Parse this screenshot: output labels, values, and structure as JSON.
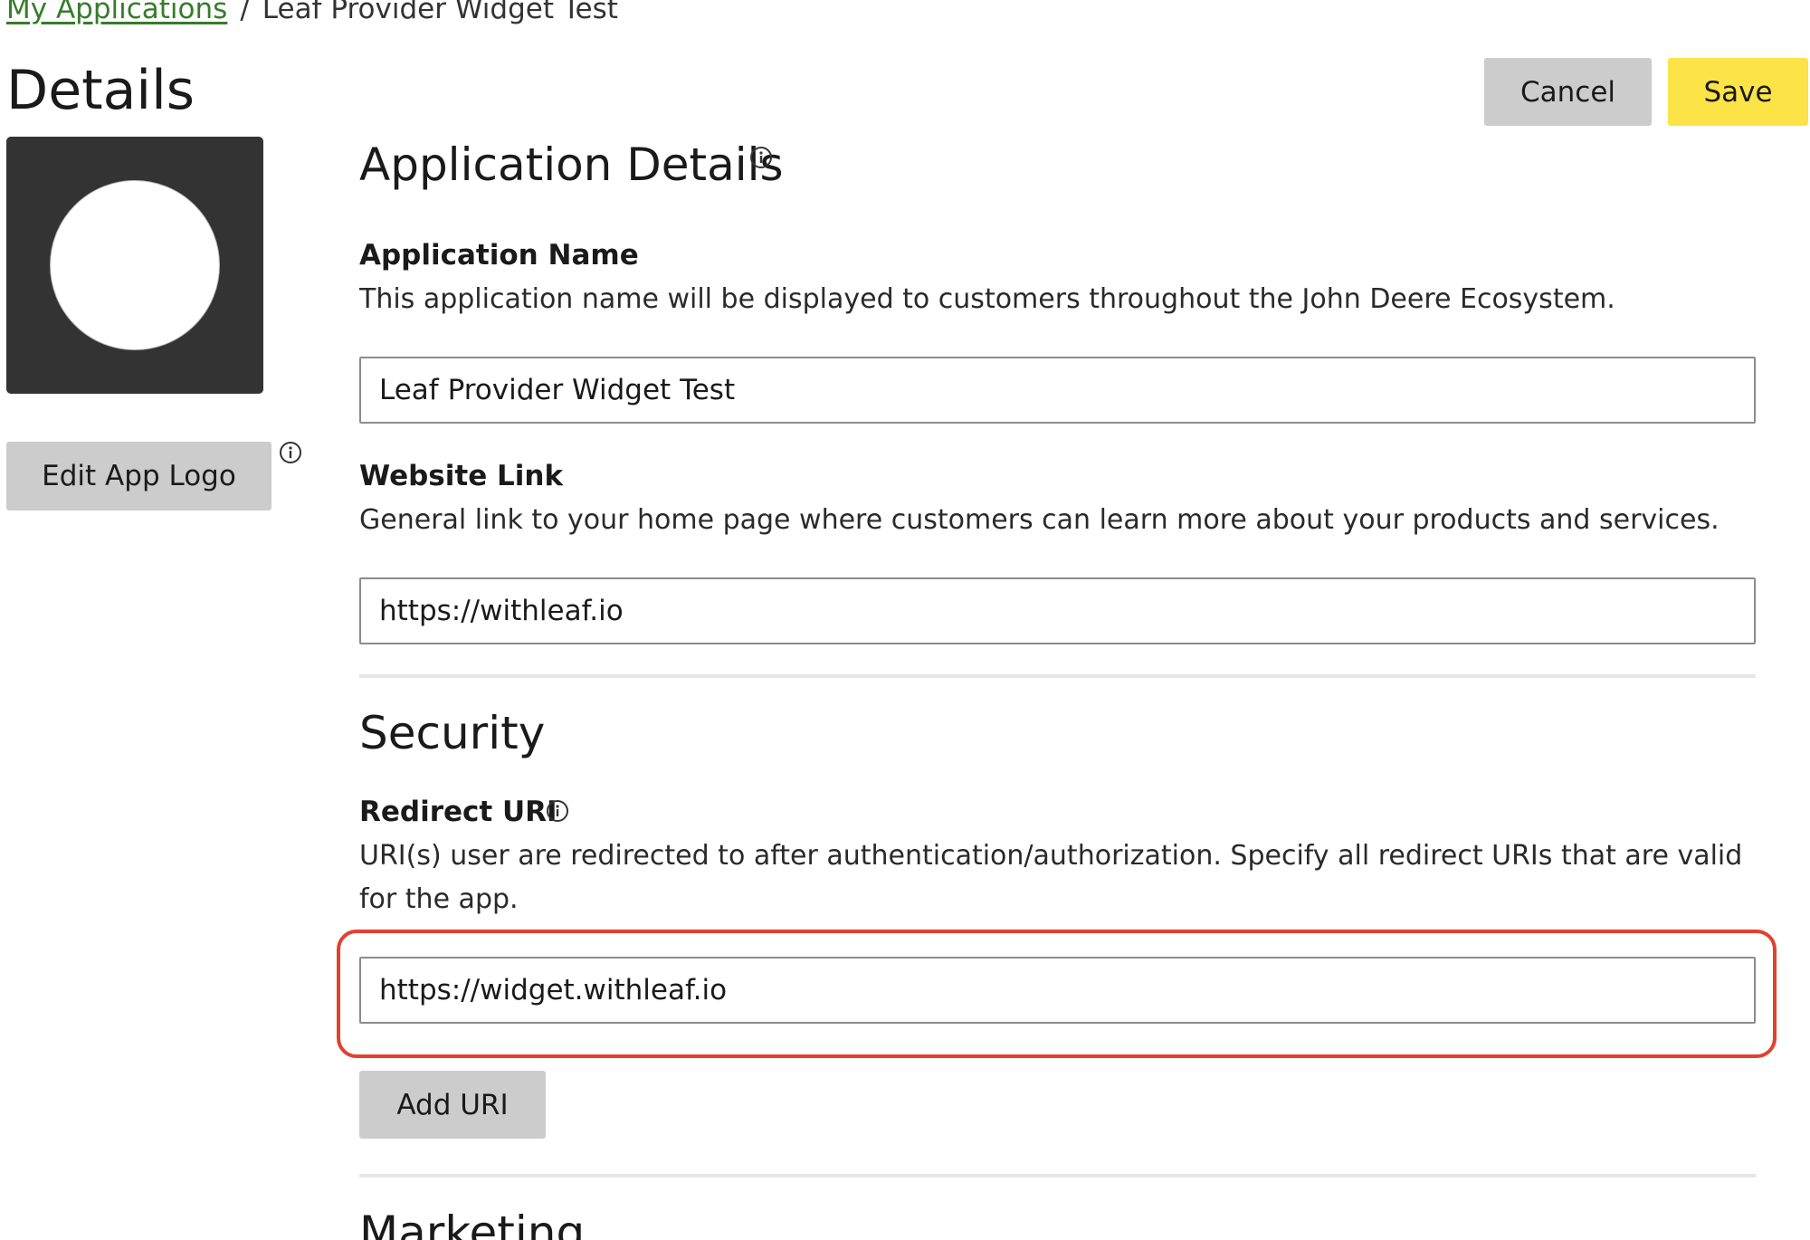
{
  "breadcrumb": {
    "parent_label": "My Applications",
    "separator": "/",
    "current_label": "Leaf Provider Widget Test"
  },
  "page_title": "Details",
  "header_actions": {
    "cancel_label": "Cancel",
    "save_label": "Save",
    "save_color": "#fbe348",
    "cancel_color": "#cccccc"
  },
  "logo_panel": {
    "edit_logo_label": "Edit App Logo",
    "info_icon": "info-icon"
  },
  "application_details": {
    "title": "Application Details",
    "info_icon": "info-icon",
    "name_field": {
      "label": "Application Name",
      "description": "This application name will be displayed to customers throughout the John Deere Ecosystem.",
      "value": "Leaf Provider Widget Test"
    },
    "website_field": {
      "label": "Website Link",
      "description": "General link to your home page where customers can learn more about your products and services.",
      "value": "https://withleaf.io"
    }
  },
  "security": {
    "title": "Security",
    "redirect_field": {
      "label": "Redirect URI",
      "info_icon": "info-icon",
      "description": "URI(s) user are redirected to after authentication/authorization. Specify all redirect URIs that are valid for the app.",
      "value": "https://widget.withleaf.io",
      "highlight_color": "#e2412e"
    },
    "add_uri_label": "Add URI"
  },
  "marketing": {
    "title": "Marketing"
  },
  "colors": {
    "link_green": "#367c2b",
    "logo_background": "#333333",
    "divider": "#e6e6e6"
  }
}
